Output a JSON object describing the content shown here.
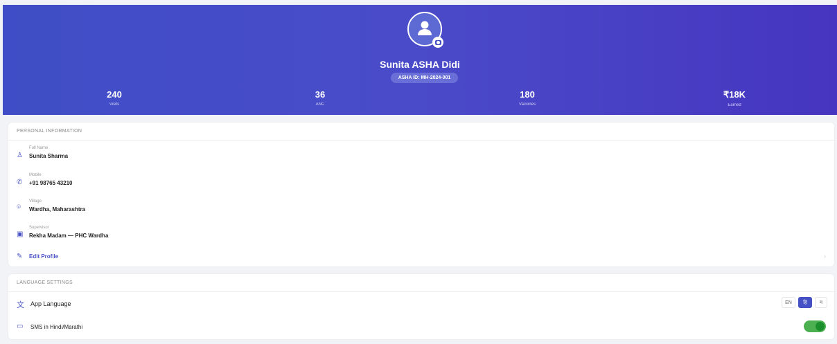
{
  "profile": {
    "name": "Sunita ASHA Didi",
    "asha_id": "ASHA ID: MH-2024-001"
  },
  "stats": [
    {
      "value": "240",
      "label": "Visits"
    },
    {
      "value": "36",
      "label": "ANC"
    },
    {
      "value": "180",
      "label": "Vaccines"
    },
    {
      "value": "₹18K",
      "label": "Earned"
    }
  ],
  "personal": {
    "heading": "PERSONAL INFORMATION",
    "full_name_label": "Full Name",
    "full_name": "Sunita Sharma",
    "mobile_label": "Mobile",
    "mobile": "+91 98765 43210",
    "village_label": "Village",
    "village": "Wardha, Maharashtra",
    "supervisor_label": "Supervisor",
    "supervisor": "Rekha Madam — PHC Wardha",
    "edit_label": "Edit Profile"
  },
  "language": {
    "heading": "LANGUAGE SETTINGS",
    "app_language_label": "App Language",
    "options": [
      "EN",
      "हि",
      "म"
    ],
    "selected": "हि",
    "sms_label": "SMS in Hindi/Marathi",
    "sms_enabled": true
  },
  "colors": {
    "primary": "#4650c5",
    "toggle_on": "#4caf50"
  },
  "icons": [
    "person-icon",
    "camera-icon",
    "user-icon",
    "phone-icon",
    "location-icon",
    "badge-icon",
    "pencil-icon",
    "chevron-right-icon",
    "translate-icon",
    "message-icon"
  ]
}
